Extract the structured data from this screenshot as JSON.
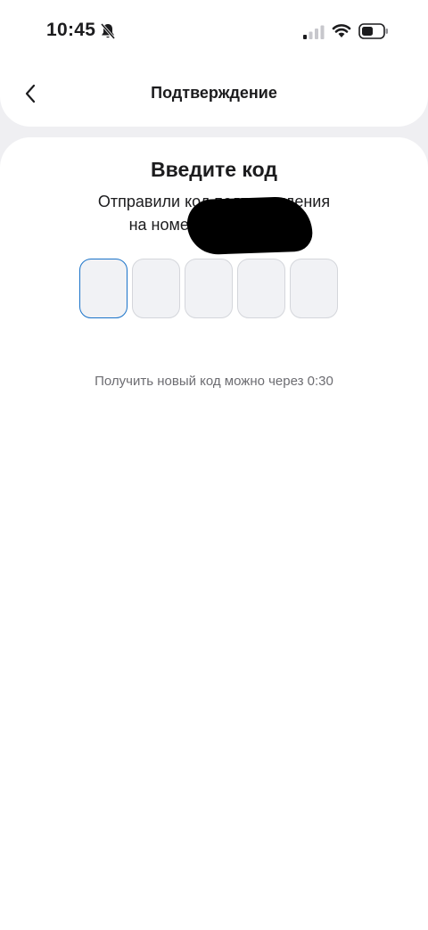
{
  "status_bar": {
    "time": "10:45",
    "icons": [
      "bell-slash-icon",
      "cellular-signal-icon",
      "wifi-icon",
      "battery-icon"
    ]
  },
  "header": {
    "back_icon": "chevron-left-icon",
    "title": "Подтверждение"
  },
  "verification": {
    "title": "Введите код",
    "description_line1": "Отправили код подтверждения",
    "description_line2": "на номер +7 ··· ··· ·· 17",
    "code_digits": [
      "",
      "",
      "",
      "",
      ""
    ],
    "resend_text": "Получить новый код можно через 0:30"
  },
  "colors": {
    "background": "#efeff2",
    "card": "#ffffff",
    "input_fill": "#f1f2f5",
    "input_border": "#d4d6db",
    "active_border": "#1a73c9",
    "secondary_text": "#6d6d72"
  }
}
